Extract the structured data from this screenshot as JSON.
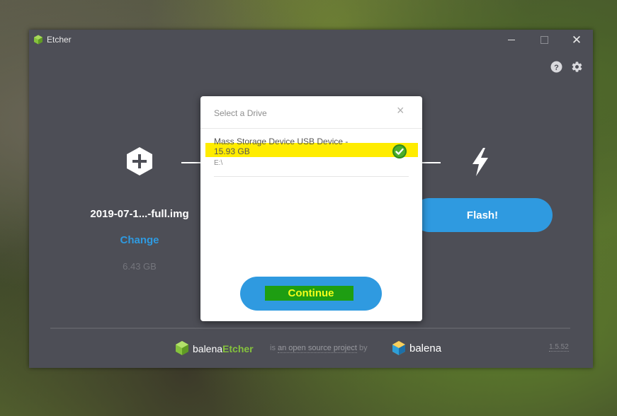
{
  "window": {
    "title": "Etcher"
  },
  "steps": {
    "image": {
      "filename": "2019-07-1...-full.img",
      "change_label": "Change",
      "size": "6.43 GB"
    },
    "flash": {
      "button_label": "Flash!"
    }
  },
  "modal": {
    "title": "Select a Drive",
    "close_glyph": "×",
    "drives": [
      {
        "name": "Mass Storage Device USB Device -",
        "size": "15.93 GB",
        "path": "E:\\",
        "selected": true
      }
    ],
    "continue_label": "Continue"
  },
  "footer": {
    "brand_prefix": "balena",
    "brand_suffix": "Etcher",
    "is_text": "is",
    "osp_text": "an open source project",
    "by_text": "by",
    "company": "balena",
    "version": "1.5.52"
  },
  "colors": {
    "accent": "#2f9ae0",
    "window_bg": "#4d4e56",
    "brand_green": "#85c23d",
    "highlight_yellow": "#ffec00",
    "highlight_green": "#1e9e12"
  },
  "icons": {
    "app": "balena-cube-icon",
    "help": "help-icon",
    "settings": "gear-icon",
    "image_step": "plus-hexagon-icon",
    "flash_step": "lightning-bolt-icon",
    "selected": "check-circle-icon"
  }
}
